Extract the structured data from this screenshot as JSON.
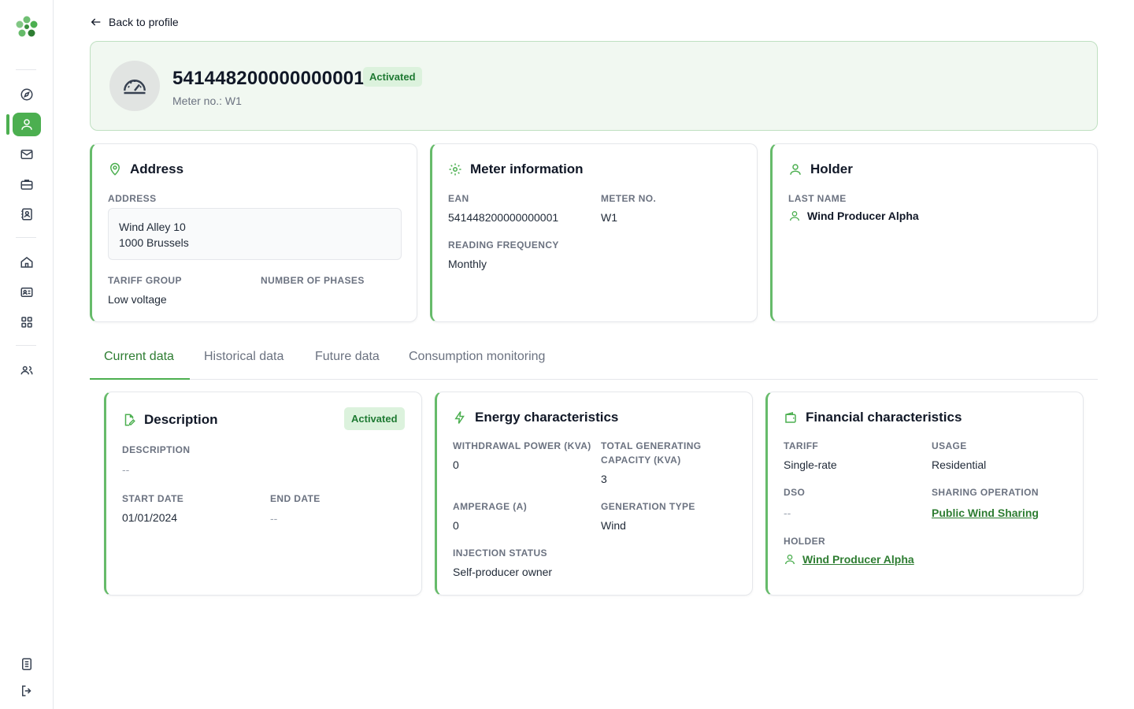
{
  "nav": {
    "back_label": "Back to profile"
  },
  "meter": {
    "ean": "541448200000000001",
    "status": "Activated",
    "subtitle": "Meter no.: W1"
  },
  "address_card": {
    "title": "Address",
    "address_label": "ADDRESS",
    "address_line1": "Wind Alley 10",
    "address_line2": "1000 Brussels",
    "tariff_group_label": "TARIFF GROUP",
    "tariff_group_value": "Low voltage",
    "phases_label": "NUMBER OF PHASES"
  },
  "meter_card": {
    "title": "Meter information",
    "ean_label": "EAN",
    "ean_value": "541448200000000001",
    "meter_no_label": "METER NO.",
    "meter_no_value": "W1",
    "reading_freq_label": "READING FREQUENCY",
    "reading_freq_value": "Monthly"
  },
  "holder_card": {
    "title": "Holder",
    "last_name_label": "LAST NAME",
    "last_name_value": "Wind Producer Alpha"
  },
  "tabs": [
    {
      "label": "Current data"
    },
    {
      "label": "Historical data"
    },
    {
      "label": "Future data"
    },
    {
      "label": "Consumption monitoring"
    }
  ],
  "description_card": {
    "title": "Description",
    "status": "Activated",
    "description_label": "DESCRIPTION",
    "description_value": "--",
    "start_date_label": "START DATE",
    "start_date_value": "01/01/2024",
    "end_date_label": "END DATE",
    "end_date_value": "--"
  },
  "energy_card": {
    "title": "Energy characteristics",
    "withdrawal_label": "WITHDRAWAL POWER (KVA)",
    "withdrawal_value": "0",
    "total_gen_label_1": "TOTAL GENERATING",
    "total_gen_label_2": "CAPACITY (KVA)",
    "total_gen_value": "3",
    "amperage_label": "AMPERAGE (A)",
    "amperage_value": "0",
    "gen_type_label": "GENERATION TYPE",
    "gen_type_value": "Wind",
    "injection_label": "INJECTION STATUS",
    "injection_value": "Self-producer owner"
  },
  "financial_card": {
    "title": "Financial characteristics",
    "tariff_label": "TARIFF",
    "tariff_value": "Single-rate",
    "usage_label": "USAGE",
    "usage_value": "Residential",
    "dso_label": "DSO",
    "dso_value": "--",
    "sharing_label": "SHARING OPERATION",
    "sharing_value": "Public Wind Sharing",
    "holder_label": "HOLDER",
    "holder_value": "Wind Producer Alpha"
  },
  "colors": {
    "accent": "#4caf50",
    "accent_dark": "#2e7d32",
    "badge_bg": "#dcf2dd"
  }
}
